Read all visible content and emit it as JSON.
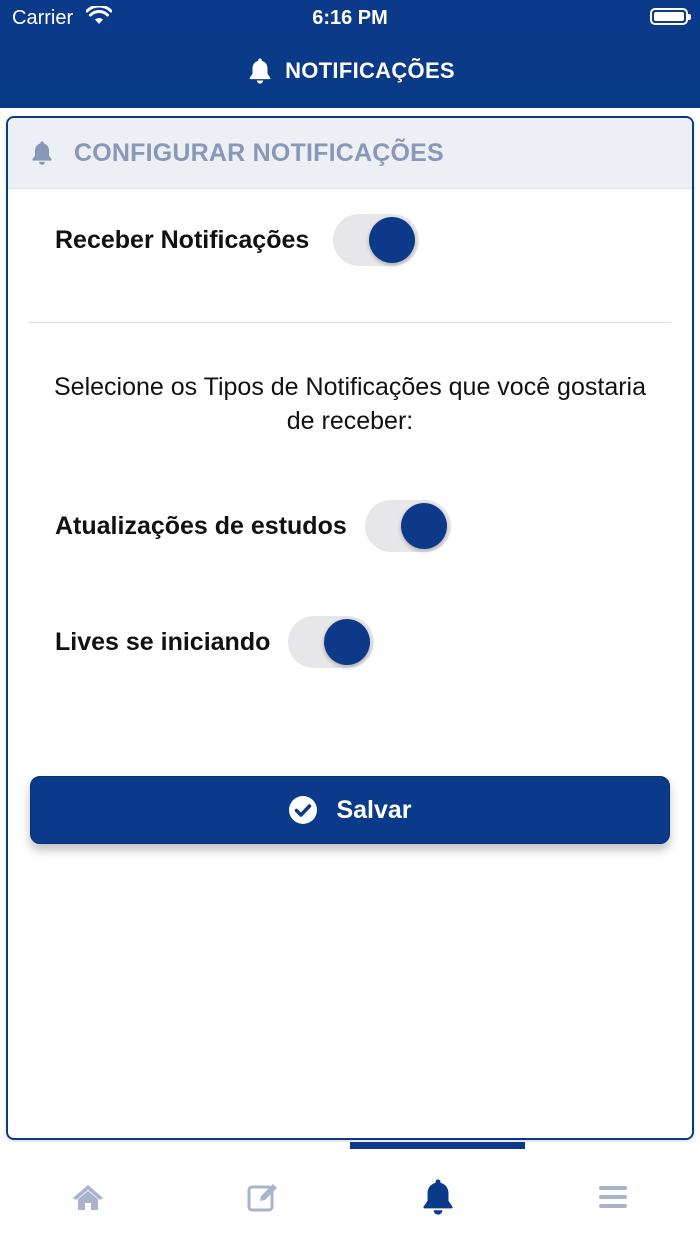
{
  "status_bar": {
    "carrier": "Carrier",
    "time": "6:16 PM"
  },
  "header": {
    "title": "NOTIFICAÇÕES",
    "icon": "bell-icon"
  },
  "card": {
    "title": "CONFIGURAR NOTIFICAÇÕES",
    "icon": "bell-icon",
    "receive": {
      "label": "Receber Notificações",
      "enabled": true
    },
    "prompt": "Selecione os Tipos de Notificações que você gostaria de receber:",
    "types": [
      {
        "label": "Atualizações de estudos",
        "enabled": true
      },
      {
        "label": "Lives se iniciando",
        "enabled": true
      }
    ],
    "save_label": "Salvar"
  },
  "tabbar": {
    "tabs": [
      {
        "name": "home",
        "icon": "home-icon",
        "active": false
      },
      {
        "name": "edit",
        "icon": "edit-icon",
        "active": false
      },
      {
        "name": "notifications",
        "icon": "bell-icon",
        "active": true
      },
      {
        "name": "menu",
        "icon": "menu-icon",
        "active": false
      }
    ]
  },
  "colors": {
    "primary": "#0b3a8a",
    "inactive_icon": "#a9b4cc",
    "card_header_text": "#8a97b8"
  }
}
